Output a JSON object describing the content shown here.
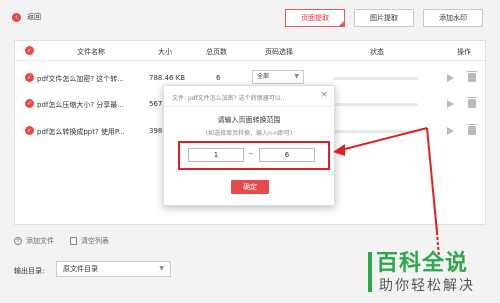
{
  "header": {
    "back_label": "返回",
    "buttons": [
      {
        "label": "页面提取",
        "active": true
      },
      {
        "label": "图片提取",
        "active": false
      },
      {
        "label": "添加水印",
        "active": false
      }
    ]
  },
  "table": {
    "columns": [
      "文件名称",
      "大小",
      "总页数",
      "页码选择",
      "状态",
      "操作"
    ],
    "rows": [
      {
        "name": "pdf文件怎么加密? 这个转...",
        "size": "788.46 KB",
        "pages": "6",
        "page_select": "全部"
      },
      {
        "name": "pdf怎么压缩大小? 分享最...",
        "size": "567.",
        "pages": "",
        "page_select": ""
      },
      {
        "name": "pdf怎么转换成ppt? 使用P...",
        "size": "398.",
        "pages": "",
        "page_select": ""
      }
    ]
  },
  "actions": {
    "add_file": "添加文件",
    "clear_list": "清空列表"
  },
  "output": {
    "label": "输出目录:",
    "value": "原文件目录"
  },
  "dialog": {
    "title": "文件: pdf文件怎么加密? 这个转换器可以...",
    "close": "×",
    "prompt": "请输入页面转换范围",
    "hint": "(如选择单页转换，输入n-n即可)",
    "from_value": "1",
    "separator": "~",
    "to_value": "6",
    "confirm_label": "确定"
  },
  "watermark": {
    "top": "百科全说",
    "bottom": "助你轻松解决"
  },
  "colors": {
    "accent": "#e54b4b",
    "highlight": "#e02020",
    "watermark_green": "#2aa84a"
  }
}
